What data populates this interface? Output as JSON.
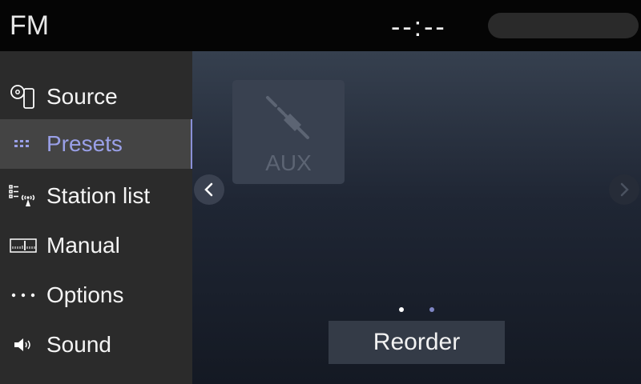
{
  "header": {
    "title": "FM",
    "clock": "--:--"
  },
  "sidebar": {
    "items": [
      {
        "label": "Source",
        "icon": "source-icon"
      },
      {
        "label": "Presets",
        "icon": "presets-icon",
        "active": true
      },
      {
        "label": "Station list",
        "icon": "station-list-icon"
      },
      {
        "label": "Manual",
        "icon": "manual-tuning-icon"
      },
      {
        "label": "Options",
        "icon": "options-icon"
      },
      {
        "label": "Sound",
        "icon": "speaker-icon"
      }
    ]
  },
  "main": {
    "preset_tile": {
      "label": "AUX",
      "icon": "aux-cable-icon"
    },
    "reorder_label": "Reorder",
    "pagination": {
      "current": 1,
      "total": 2
    }
  },
  "colors": {
    "accent": "#9aa0e8",
    "sidebar_bg": "#2b2b2b",
    "active_bg": "#444444"
  }
}
